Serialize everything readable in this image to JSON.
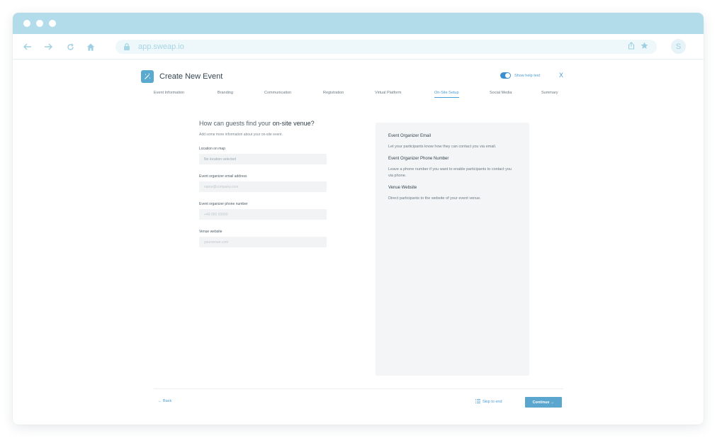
{
  "browser": {
    "url": "app.sweap.io",
    "profile_initial": "S",
    "accent": "#b3dcea"
  },
  "app": {
    "title": "Create New Event",
    "help_toggle_label": "Show help text",
    "help_toggle_on": true,
    "close_symbol": "X",
    "tabs": [
      {
        "label": "Event Information",
        "active": false
      },
      {
        "label": "Branding",
        "active": false
      },
      {
        "label": "Communication",
        "active": false
      },
      {
        "label": "Registration",
        "active": false
      },
      {
        "label": "Virtual Platform",
        "active": false
      },
      {
        "label": "On-Site Setup",
        "active": true
      },
      {
        "label": "Social Media",
        "active": false
      },
      {
        "label": "Summary",
        "active": false
      }
    ]
  },
  "form": {
    "title_prefix": "How can guests find your ",
    "title_emphasis": "on-site venue?",
    "subtitle": "Add some more information about your on-site event.",
    "fields": [
      {
        "label": "Location on map",
        "value": "No location selected",
        "placeholder": ""
      },
      {
        "label": "Event organizer email address",
        "value": "",
        "placeholder": "name@company.com"
      },
      {
        "label": "Event organizer phone number",
        "value": "",
        "placeholder": "+49 000 00000"
      },
      {
        "label": "Venue website",
        "value": "",
        "placeholder": "yourvenue.com"
      }
    ]
  },
  "help_panel": {
    "sections": [
      {
        "heading": "Event Organizer Email",
        "text": "Let your participants know how they can contact you via email."
      },
      {
        "heading": "Event Organizer Phone Number",
        "text": "Leave a phone number if you want to enable participants to contact you via phone."
      },
      {
        "heading": "Venue Website",
        "text": "Direct participants to the website of your event venue."
      }
    ]
  },
  "footer": {
    "back_label": "← Back",
    "skip_label": "Skip to end",
    "continue_label": "Continue →"
  },
  "colors": {
    "primary": "#4b9bd3",
    "button": "#5aa6cf"
  }
}
